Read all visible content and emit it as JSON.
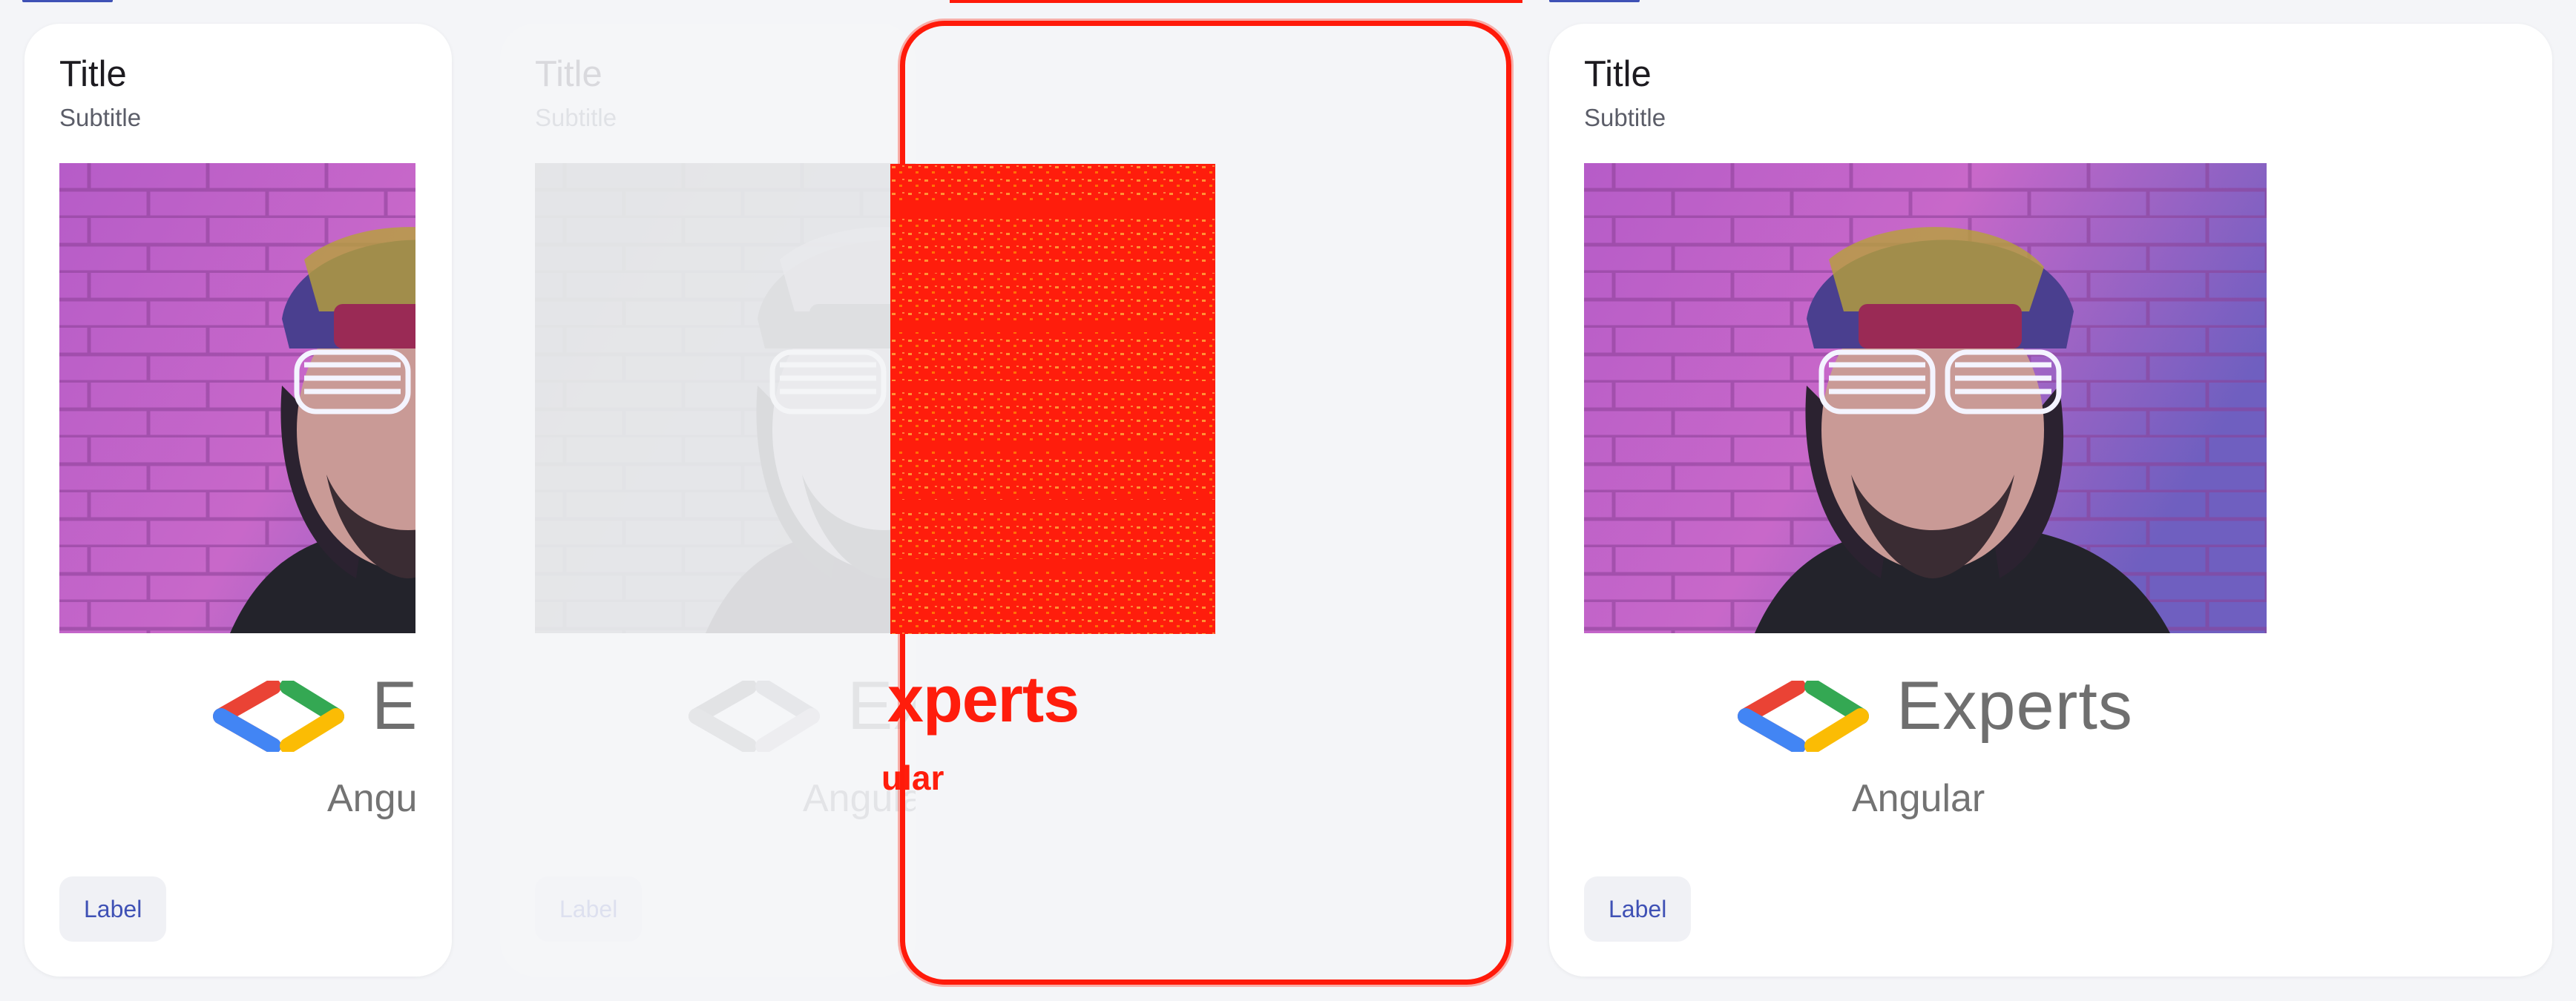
{
  "cards": [
    {
      "title": "Title",
      "subtitle": "Subtitle",
      "brand_word": "Experts",
      "brand_sub": "Angular",
      "chip_label": "Label"
    },
    {
      "title": "Title",
      "subtitle": "Subtitle",
      "brand_word": "Experts",
      "brand_sub": "Angular",
      "chip_label": "Label"
    },
    {
      "title": "Title",
      "subtitle": "Subtitle",
      "brand_word": "Experts",
      "brand_sub": "Angular",
      "chip_label": "Label"
    }
  ],
  "overlay": {
    "brand_word": "xperts",
    "brand_sub": "ular"
  },
  "colors": {
    "accent": "#3f51b5",
    "overlay": "#ff1d0c",
    "title": "#1d1b20",
    "subtitle": "#5b5d68"
  },
  "icons": [
    "developer-experts-logo-icon"
  ]
}
